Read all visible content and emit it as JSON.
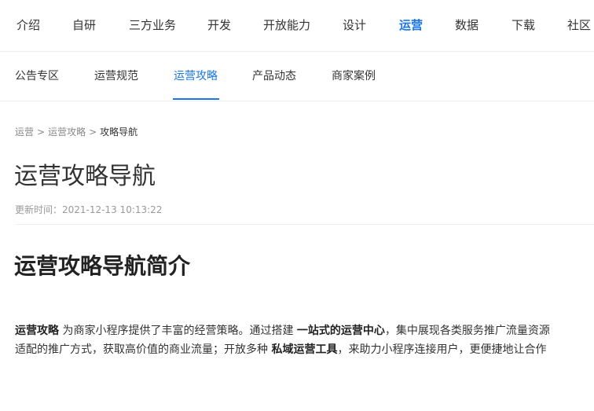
{
  "top_nav": {
    "items": [
      "介绍",
      "自研",
      "三方业务",
      "开发",
      "开放能力",
      "设计",
      "运营",
      "数据",
      "下载",
      "社区"
    ],
    "active": "运营"
  },
  "sub_nav": {
    "items": [
      "公告专区",
      "运营规范",
      "运营攻略",
      "产品动态",
      "商家案例"
    ],
    "active": "运营攻略"
  },
  "breadcrumb": {
    "items": [
      "运营",
      "运营攻略",
      "攻略导航"
    ],
    "separator": ">"
  },
  "title": "运营攻略导航",
  "update_time": "更新时间：2021-12-13 10:13:22",
  "section_heading": "运营攻略导航简介",
  "intro": {
    "line1": {
      "b1": "运营攻略",
      "t1": " 为商家小程序提供了丰富的经营策略。通过搭建 ",
      "b2": "一站式的运营中心",
      "t2": "，集中展现各类服务推广流量资源"
    },
    "line2": {
      "t1": "适配的推广方式，获取高价值的商业流量；开放多种 ",
      "b1": "私域运营工具",
      "t2": "，来助力小程序连接用户，更便捷地让合作"
    }
  },
  "colors": {
    "accent": "#1a76e8",
    "text": "#333333",
    "muted": "#999999",
    "border": "#eeeeee"
  }
}
